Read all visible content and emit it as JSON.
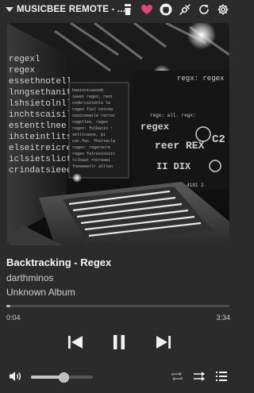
{
  "app": {
    "title": "MUSICBEE REMOTE - ..."
  },
  "titlebar_icons": [
    "cup-icon",
    "heart-icon",
    "github-icon",
    "plug-icon",
    "refresh-icon",
    "gear-icon"
  ],
  "colors": {
    "background": "#2b2b2b",
    "heart": "#e2457b",
    "text": "#f5f5f5"
  },
  "now_playing": {
    "title": "Backtracking - Regex",
    "artist": "darthminos",
    "album": "Unknown Album",
    "artwork_text": {
      "left_wall": [
        "regexl",
        "regex",
        "essethnotell",
        "lnngsethanit",
        "lshsietolnll",
        "inchtscaisili",
        "estenttlnee",
        "ihsteintlitsl",
        "elseitreicreli",
        "iclsietslictei",
        "crindatsieeei"
      ],
      "screen_left": "regex",
      "screen_right": [
        "regx: regex",
        "rear REX",
        "II DIX",
        "C2"
      ]
    }
  },
  "playback": {
    "elapsed": "0:04",
    "total": "3:34",
    "progress_fraction": 0.019
  },
  "volume": {
    "level_fraction": 0.52
  }
}
